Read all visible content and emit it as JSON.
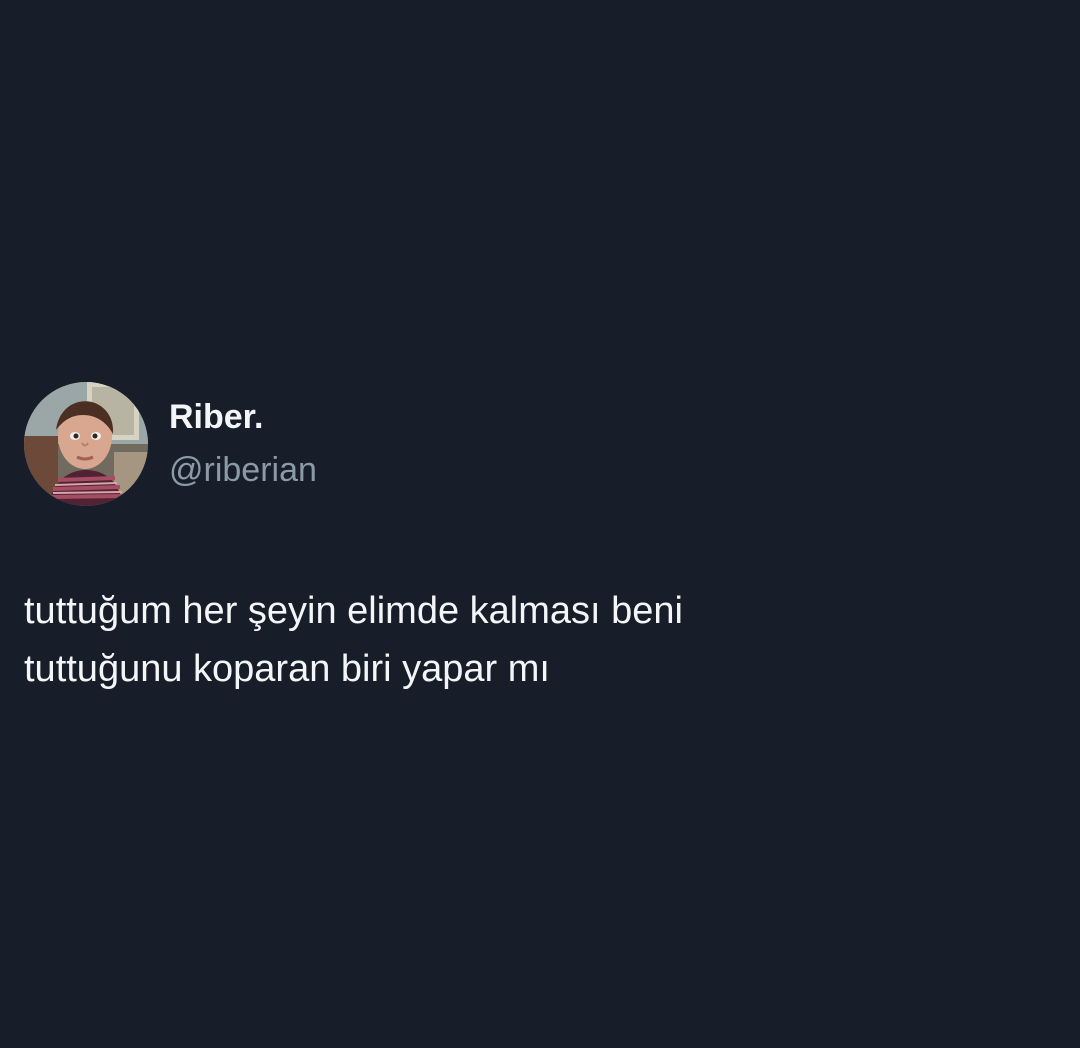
{
  "tweet": {
    "author": {
      "display_name": "Riber.",
      "handle": "@riberian"
    },
    "text_lines": [
      "tuttuğum her şeyin elimde kalması beni",
      "tuttuğunu koparan biri yapar mı"
    ]
  },
  "colors": {
    "background": "#171e29",
    "primary_text": "#f3f5f7",
    "secondary_text": "#8c99a6"
  },
  "icons": {
    "avatar": "child-photo-avatar"
  }
}
